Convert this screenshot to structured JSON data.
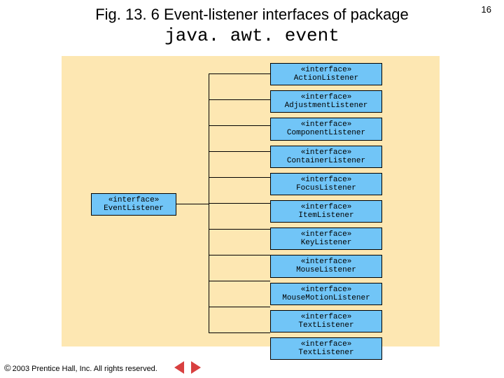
{
  "page_number": "16",
  "header": {
    "line1": "Fig. 13. 6  Event-listener interfaces of package",
    "line2": "java. awt. event"
  },
  "parent": {
    "stereotype": "«interface»",
    "name": "EventListener"
  },
  "children": [
    {
      "stereotype": "«interface»",
      "name": "ActionListener"
    },
    {
      "stereotype": "«interface»",
      "name": "AdjustmentListener"
    },
    {
      "stereotype": "«interface»",
      "name": "ComponentListener"
    },
    {
      "stereotype": "«interface»",
      "name": "ContainerListener"
    },
    {
      "stereotype": "«interface»",
      "name": "FocusListener"
    },
    {
      "stereotype": "«interface»",
      "name": "ItemListener"
    },
    {
      "stereotype": "«interface»",
      "name": "KeyListener"
    },
    {
      "stereotype": "«interface»",
      "name": "MouseListener"
    },
    {
      "stereotype": "«interface»",
      "name": "MouseMotionListener"
    },
    {
      "stereotype": "«interface»",
      "name": "TextListener"
    },
    {
      "stereotype": "«interface»",
      "name": "TextListener"
    }
  ],
  "footer": {
    "copyright": "2003 Prentice Hall, Inc.  All rights reserved."
  },
  "nav": {
    "prev": "previous-slide",
    "next": "next-slide"
  },
  "colors": {
    "panel_bg": "#fde7b2",
    "box_fill": "#71c5f7",
    "nav_tri": "#d84040"
  }
}
